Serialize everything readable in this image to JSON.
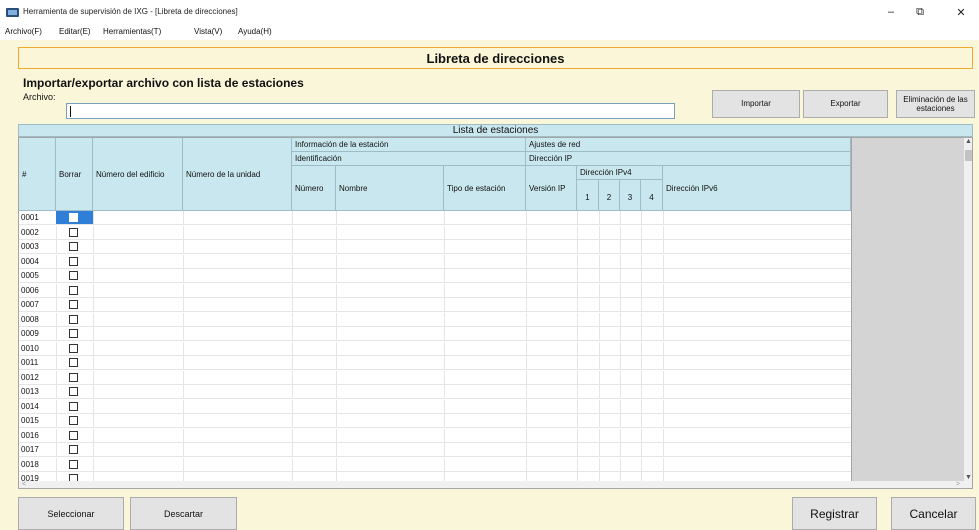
{
  "window": {
    "title": "Herramienta de supervisión de IXG - [Libreta de direcciones]",
    "minimize": "–",
    "maximize": "⧉",
    "close": "✕"
  },
  "menu": [
    {
      "label": "Archivo(F)"
    },
    {
      "label": "Editar(E)"
    },
    {
      "label": "Herramientas(T)"
    },
    {
      "label": "Vista(V)"
    },
    {
      "label": "Ayuda(H)"
    }
  ],
  "page": {
    "title": "Libreta de direcciones",
    "import_section_title": "Importar/exportar archivo con lista de estaciones",
    "file_label": "Archivo:",
    "file_value": ""
  },
  "buttons": {
    "import": "Importar",
    "export": "Exportar",
    "delete_stations": "Eliminación de las estaciones",
    "select": "Seleccionar",
    "discard": "Descartar",
    "register": "Registrar",
    "cancel": "Cancelar"
  },
  "table": {
    "title": "Lista de estaciones",
    "headers": {
      "num": "#",
      "delete": "Borrar",
      "building": "Número del edificio",
      "unit": "Número de la unidad",
      "station_info": "Información de la estación",
      "identification": "Identificación",
      "number": "Número",
      "name": "Nombre",
      "station_type": "Tipo de estación",
      "network": "Ajustes de red",
      "ip_address": "Dirección IP",
      "ip_version": "Versión IP",
      "ipv4": "Dirección IPv4",
      "ipv4_1": "1",
      "ipv4_2": "2",
      "ipv4_3": "3",
      "ipv4_4": "4",
      "ipv6": "Dirección IPv6"
    },
    "rows": [
      "0001",
      "0002",
      "0003",
      "0004",
      "0005",
      "0006",
      "0007",
      "0008",
      "0009",
      "0010",
      "0011",
      "0012",
      "0013",
      "0014",
      "0015",
      "0016",
      "0017",
      "0018",
      "0019"
    ],
    "selected_row": 0
  },
  "icons": {
    "app": "app-icon",
    "scroll_up": "▲",
    "scroll_down": "▼",
    "scroll_left": "<",
    "scroll_right": ">"
  }
}
